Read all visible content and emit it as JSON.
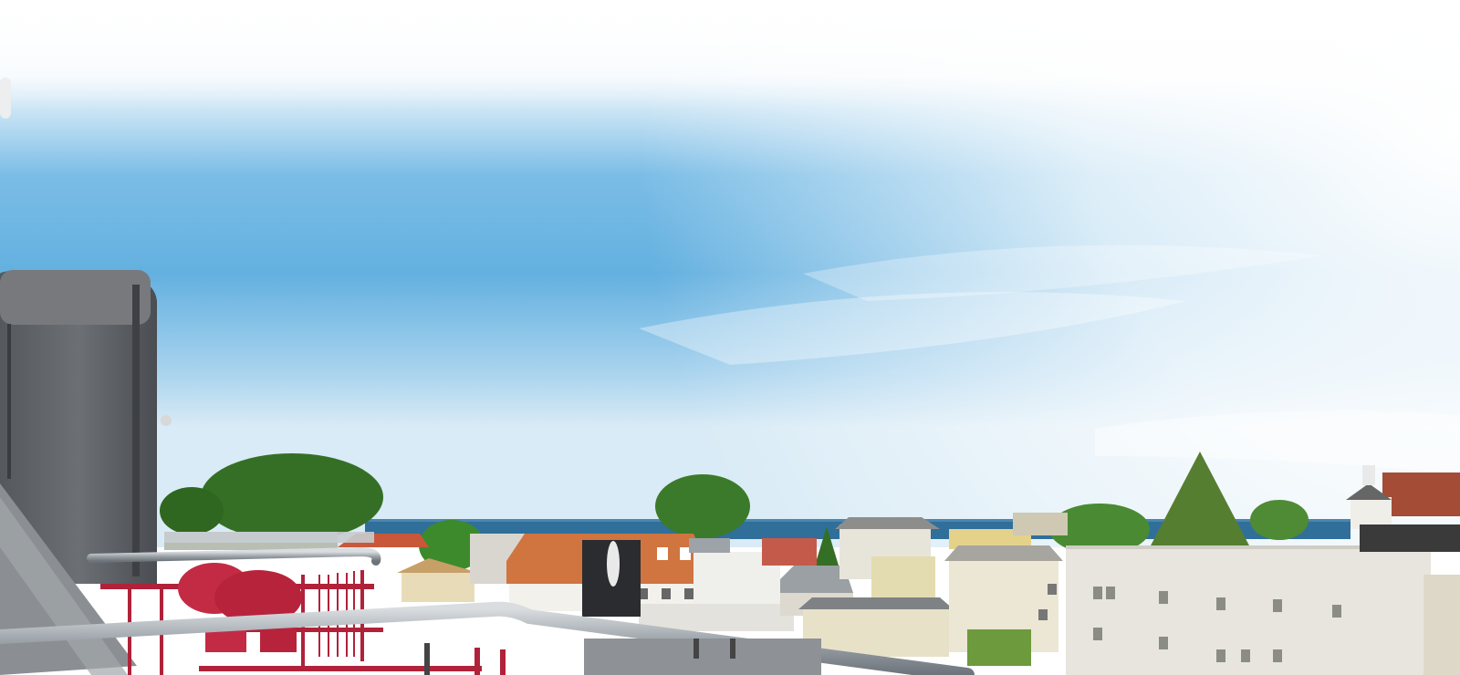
{
  "photo": {
    "subject": "balcony-view-over-seaside-town",
    "colors": {
      "sky_top": "#ffffff",
      "sky_blue": "#5aa9dc",
      "sea": "#2f6f9a",
      "tree": "#3b7a2a",
      "roof_red": "#c9683a",
      "railing_red": "#b0223a",
      "steel": "#a7adb3"
    }
  }
}
